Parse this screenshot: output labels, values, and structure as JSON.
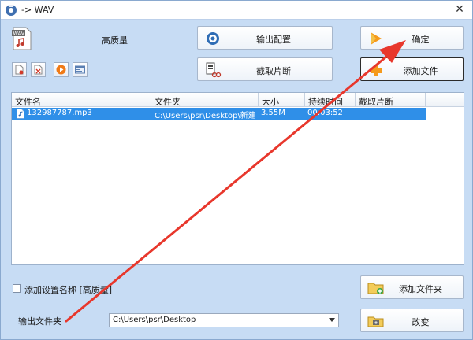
{
  "window": {
    "title": "-> WAV",
    "close_label": "✕"
  },
  "quality": {
    "badge": "WAV",
    "label": "高质量"
  },
  "buttons": {
    "output_config": "输出配置",
    "confirm": "确定",
    "cut_clip": "截取片断",
    "add_file": "添加文件",
    "add_folder": "添加文件夹",
    "change": "改变"
  },
  "file_list": {
    "columns": [
      "文件名",
      "文件夹",
      "大小",
      "持续时间",
      "截取片断"
    ],
    "rows": [
      {
        "name": "132987787.mp3",
        "folder": "C:\\Users\\psr\\Desktop\\新建 ...",
        "size": "3.55M",
        "duration": "00:03:52",
        "clip": ""
      }
    ]
  },
  "options": {
    "add_setting_name": "添加设置名称 [高质量]",
    "checked": false
  },
  "output": {
    "label": "输出文件夹",
    "folder": "C:\\Users\\psr\\Desktop"
  },
  "colors": {
    "background": "#c7dcf4",
    "selection": "#2f8fe8",
    "annotation_arrow": "#e8372c"
  }
}
